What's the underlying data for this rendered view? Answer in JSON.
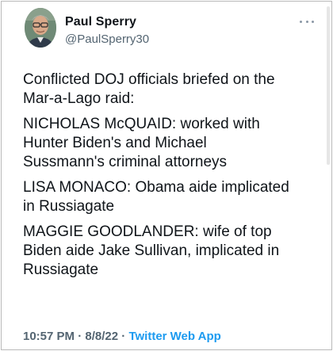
{
  "author": {
    "display_name": "Paul Sperry",
    "handle": "@PaulSperry30"
  },
  "icons": {
    "more": "more-horizontal-icon",
    "avatar": "profile-photo"
  },
  "tweet": {
    "paragraphs": [
      "Conflicted DOJ officials briefed on the\nMar-a-Lago raid:",
      "NICHOLAS McQUAID: worked with\nHunter Biden's and Michael\nSussmann's criminal attorneys",
      "LISA MONACO: Obama aide implicated\nin Russiagate",
      "MAGGIE GOODLANDER: wife of top\nBiden aide Jake Sullivan, implicated in\nRussiagate"
    ]
  },
  "meta": {
    "time": "10:57 PM",
    "separator": " · ",
    "date": "8/8/22",
    "source": "Twitter Web App"
  },
  "colors": {
    "text": "#0f1419",
    "secondary": "#536471",
    "link": "#1d9bf0"
  }
}
